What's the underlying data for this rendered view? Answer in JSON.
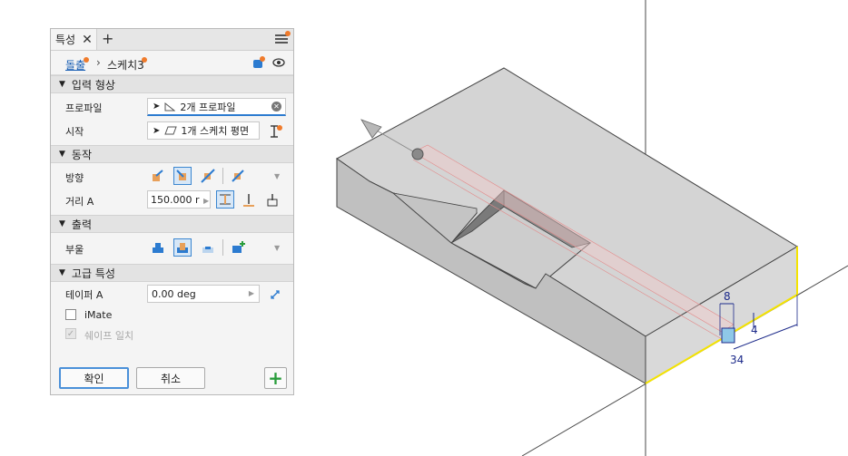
{
  "panel": {
    "tab_title": "특성",
    "tab_close": "✕",
    "tab_add": "+",
    "breadcrumb": {
      "root": "돌출",
      "separator": "›",
      "current": "스케치3"
    },
    "sections": {
      "input": {
        "title": "입력 형상",
        "profile_label": "프로파일",
        "profile_value": "2개 프로파일",
        "start_label": "시작",
        "start_value": "1개 스케치 평면"
      },
      "behavior": {
        "title": "동작",
        "direction_label": "방향",
        "distance_label": "거리 A",
        "distance_value": "150.000 r"
      },
      "output": {
        "title": "출력",
        "boolean_label": "부울"
      },
      "advanced": {
        "title": "고급 특성",
        "taper_label": "테이퍼 A",
        "taper_value": "0.00 deg",
        "imate_label": "iMate",
        "shape_match_label": "쉐이프 일치"
      }
    },
    "buttons": {
      "ok": "확인",
      "cancel": "취소",
      "add": "+"
    }
  },
  "viewport": {
    "dims": {
      "d1": "8",
      "d2": "4",
      "d3": "34"
    }
  },
  "colors": {
    "accent": "#2c7bd0",
    "notification": "#f07b2c",
    "edge_highlight": "#f5e400",
    "add_green": "#2a9d3c",
    "dimension": "#1c2a8a"
  }
}
